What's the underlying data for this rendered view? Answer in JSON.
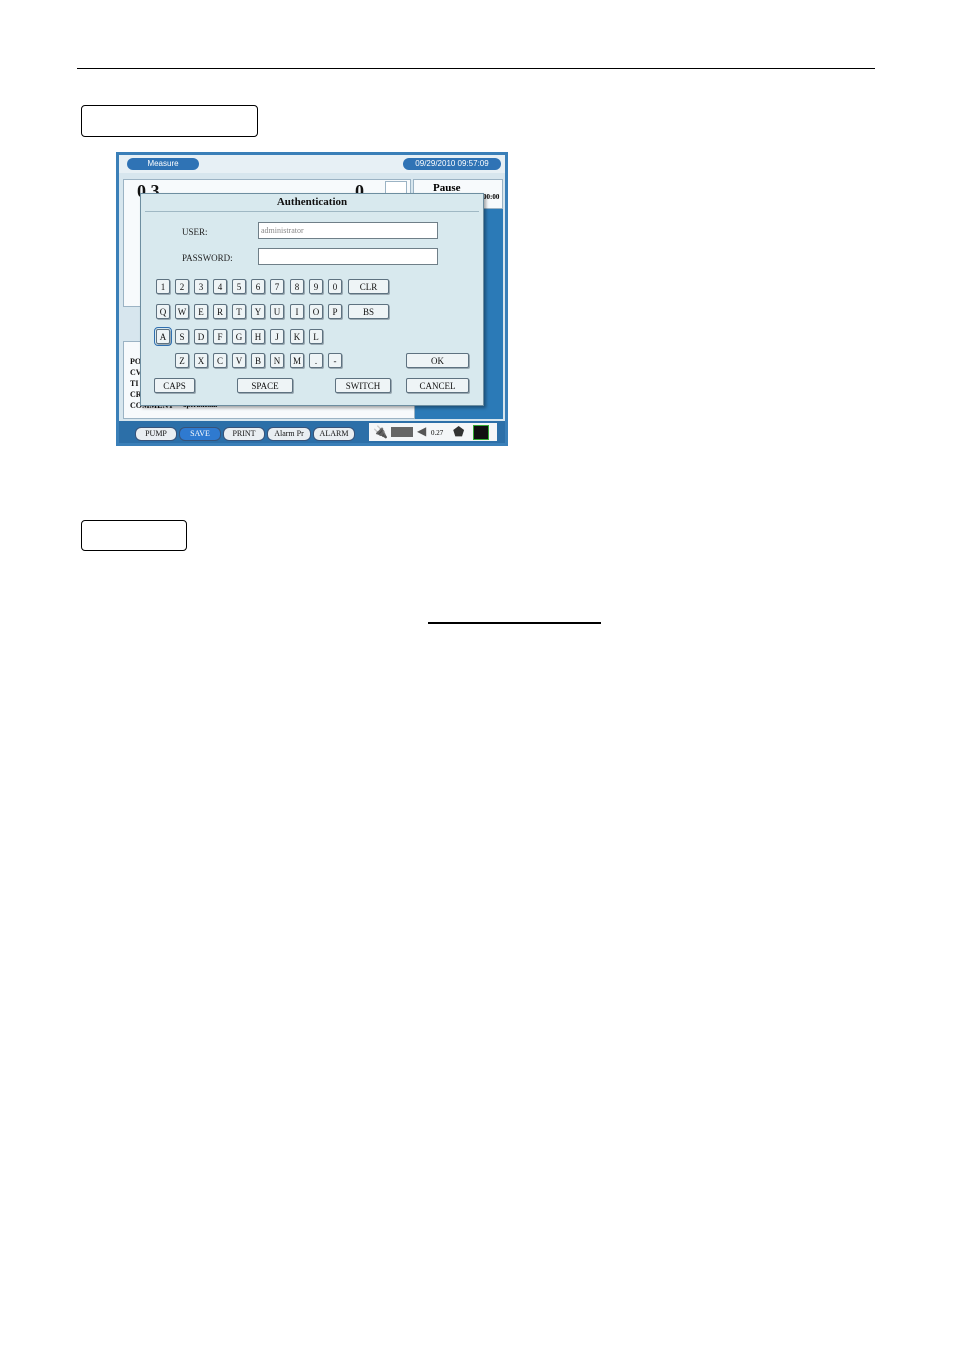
{
  "header": {
    "rule": true
  },
  "screen": {
    "tab": "Measure",
    "datetime": "09/29/2010 09:57:09",
    "status": "Pause",
    "time_small": "00:00",
    "big_left": "0.3",
    "big_right": "0",
    "side_labels": [
      "PO",
      "CV",
      "TI",
      "CR"
    ],
    "comment_label": "COMMENT",
    "comment_value": "operational",
    "bottom_buttons": [
      "PUMP",
      "SAVE",
      "PRINT",
      "Alarm Pr",
      "ALARM"
    ],
    "status_value": "0.27"
  },
  "dialog": {
    "title": "Authentication",
    "user_label": "USER:",
    "user_value": "administrator",
    "password_label": "PASSWORD:",
    "password_value": "",
    "row1": [
      "1",
      "2",
      "3",
      "4",
      "5",
      "6",
      "7",
      "8",
      "9",
      "0"
    ],
    "row2": [
      "Q",
      "W",
      "E",
      "R",
      "T",
      "Y",
      "U",
      "I",
      "O",
      "P"
    ],
    "row3": [
      "A",
      "S",
      "D",
      "F",
      "G",
      "H",
      "J",
      "K",
      "L"
    ],
    "row4": [
      "Z",
      "X",
      "C",
      "V",
      "B",
      "N",
      "M",
      ".",
      "-"
    ],
    "clr": "CLR",
    "bs": "BS",
    "ok": "OK",
    "caps": "CAPS",
    "space": "SPACE",
    "switch": "SWITCH",
    "cancel": "CANCEL"
  }
}
